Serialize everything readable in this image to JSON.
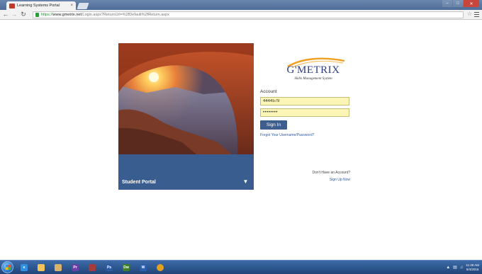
{
  "browser": {
    "tab_title": "Learning Systems Portal",
    "tab_close": "×",
    "url_scheme": "https://",
    "url_host": "www.gmetrix.net",
    "url_path": "/Login.aspx?ReturnUrl=%2fDefault%2fReturn.aspx",
    "window_controls": [
      "–",
      "□",
      "✕"
    ]
  },
  "portal": {
    "label": "Student Portal",
    "arrow_glyph": "▼"
  },
  "logo": {
    "wordmark": "G'METRIX",
    "tagline": "Skills Management System"
  },
  "login": {
    "account_label": "Account",
    "username_value": "4444579",
    "password_value": "••••••••",
    "signin_label": "Sign In",
    "forgot_link": "Forgot Your Username/Password?",
    "no_account_text": "Don't Have an Account?",
    "signup_link": "Sign Up Now"
  },
  "taskbar": {
    "apps": [
      {
        "name": "ie",
        "label": "e",
        "color": "#2f8fe3"
      },
      {
        "name": "explorer",
        "label": "",
        "color": "#f2c45b"
      },
      {
        "name": "folder",
        "label": "",
        "color": "#d9b36a"
      },
      {
        "name": "premiere",
        "label": "Pr",
        "color": "#6b3fa6"
      },
      {
        "name": "media",
        "label": "",
        "color": "#a43c3c"
      },
      {
        "name": "photoshop",
        "label": "Ps",
        "color": "#2d5aa0"
      },
      {
        "name": "dreamweaver",
        "label": "Dw",
        "color": "#3f7f2a"
      },
      {
        "name": "word",
        "label": "W",
        "color": "#2a5fb0"
      },
      {
        "name": "chrome",
        "label": "",
        "color": "#e0a020"
      }
    ],
    "clock_time": "11:49 AM",
    "clock_date": "5/4/2016"
  },
  "colors": {
    "accent": "#3e5e8d",
    "field_bg": "#fbf6b6",
    "logo_orange": "#f0a020",
    "logo_blue": "#2b3c86"
  }
}
